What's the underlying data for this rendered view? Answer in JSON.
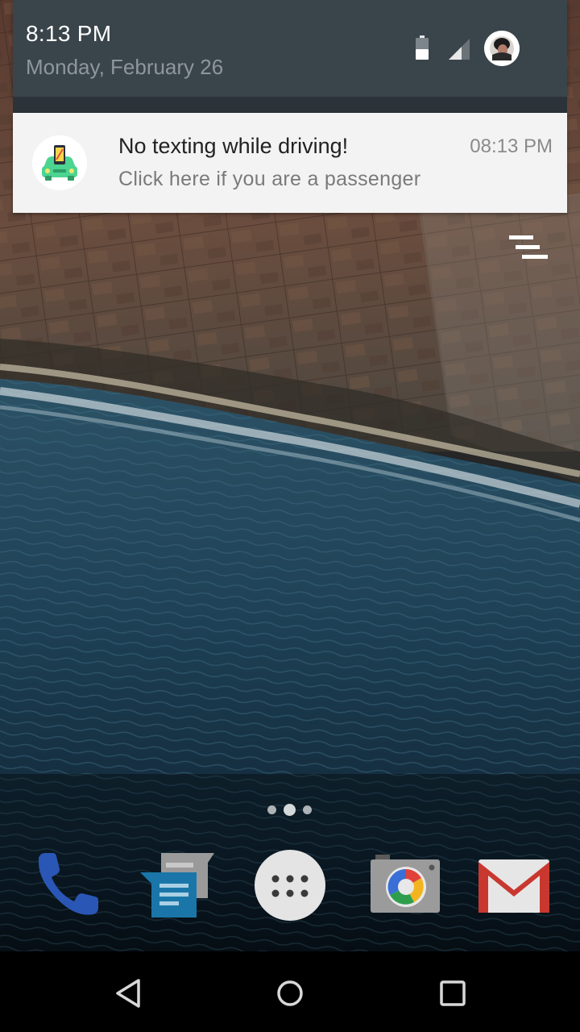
{
  "status_shade": {
    "time": "8:13 PM",
    "date": "Monday, February 26"
  },
  "notification": {
    "title": "No texting while driving!",
    "text": "Click here if you are a passenger",
    "time": "08:13 PM",
    "icon": "car-phone-icon"
  },
  "dock": {
    "apps": [
      {
        "name": "Phone",
        "icon": "phone-icon"
      },
      {
        "name": "Messages",
        "icon": "messages-icon"
      },
      {
        "name": "Apps",
        "icon": "app-drawer-icon"
      },
      {
        "name": "Camera",
        "icon": "camera-icon"
      },
      {
        "name": "Gmail",
        "icon": "gmail-icon"
      }
    ]
  },
  "page_indicator": {
    "pages": 3,
    "current": 2
  },
  "colors": {
    "shade": "#3a444b",
    "card": "#f3f3f3",
    "accent_green": "#4cd491"
  }
}
